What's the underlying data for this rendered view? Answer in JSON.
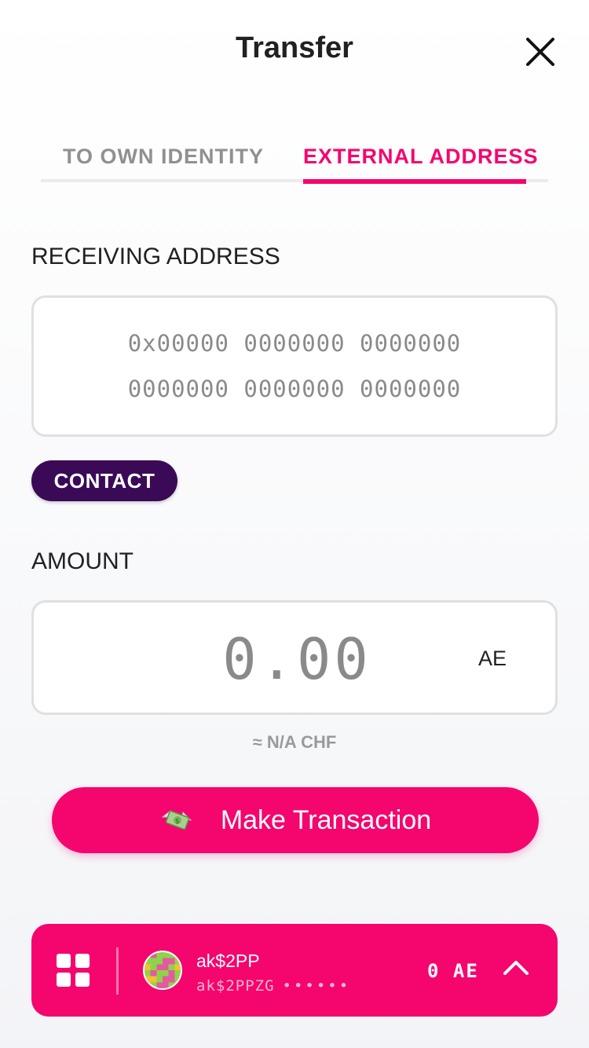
{
  "header": {
    "title": "Transfer",
    "close_icon": "close-icon"
  },
  "tabs": [
    {
      "label": "TO OWN IDENTITY",
      "active": false
    },
    {
      "label": "EXTERNAL ADDRESS",
      "active": true
    }
  ],
  "receiving": {
    "label": "RECEIVING ADDRESS",
    "placeholder_line1": "0x00000 0000000 0000000",
    "placeholder_line2": "0000000 0000000 0000000",
    "contact_button": "CONTACT"
  },
  "amount": {
    "label": "AMOUNT",
    "placeholder": "0.00",
    "unit": "AE",
    "fiat": "≈ N/A CHF"
  },
  "action": {
    "label": "Make Transaction",
    "icon": "money-with-wings-icon"
  },
  "account": {
    "menu_icon": "grid-icon",
    "name": "ak$2PP",
    "address": "ak$2PPZG",
    "address_dots": "••••••",
    "balance": "0 AE",
    "expand_icon": "chevron-up-icon"
  },
  "colors": {
    "accent": "#f5056e",
    "contact_bg": "#3a0a57",
    "tab_inactive": "#909090",
    "placeholder_text": "#8a8a8a"
  }
}
